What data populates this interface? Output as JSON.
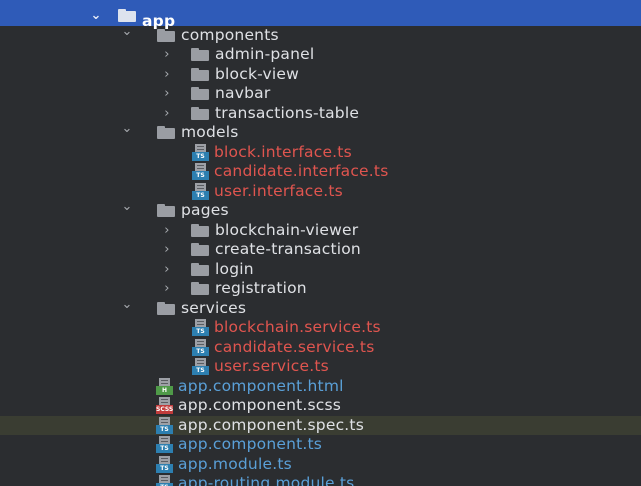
{
  "tree": {
    "colors": {
      "background": "#2b2d30",
      "selection": "#2f5bb8",
      "error_file": "#e0554f",
      "modified_file": "#5aa0d8",
      "normal_text": "#dfe1e5",
      "highlight_row": "#3a3d32"
    },
    "rows": [
      {
        "label": "app",
        "kind": "folder",
        "expanded": true,
        "state": "selected"
      },
      {
        "label": "components",
        "kind": "folder",
        "expanded": true
      },
      {
        "label": "admin-panel",
        "kind": "folder",
        "expanded": false
      },
      {
        "label": "block-view",
        "kind": "folder",
        "expanded": false
      },
      {
        "label": "navbar",
        "kind": "folder",
        "expanded": false
      },
      {
        "label": "transactions-table",
        "kind": "folder",
        "expanded": false
      },
      {
        "label": "models",
        "kind": "folder",
        "expanded": true
      },
      {
        "label": "block.interface.ts",
        "kind": "file",
        "icon": "TS",
        "status": "error"
      },
      {
        "label": "candidate.interface.ts",
        "kind": "file",
        "icon": "TS",
        "status": "error"
      },
      {
        "label": "user.interface.ts",
        "kind": "file",
        "icon": "TS",
        "status": "error"
      },
      {
        "label": "pages",
        "kind": "folder",
        "expanded": true
      },
      {
        "label": "blockchain-viewer",
        "kind": "folder",
        "expanded": false
      },
      {
        "label": "create-transaction",
        "kind": "folder",
        "expanded": false
      },
      {
        "label": "login",
        "kind": "folder",
        "expanded": false
      },
      {
        "label": "registration",
        "kind": "folder",
        "expanded": false
      },
      {
        "label": "services",
        "kind": "folder",
        "expanded": true
      },
      {
        "label": "blockchain.service.ts",
        "kind": "file",
        "icon": "TS",
        "status": "error"
      },
      {
        "label": "candidate.service.ts",
        "kind": "file",
        "icon": "TS",
        "status": "error"
      },
      {
        "label": "user.service.ts",
        "kind": "file",
        "icon": "TS",
        "status": "error"
      },
      {
        "label": "app.component.html",
        "kind": "file",
        "icon": "H",
        "status": "modified"
      },
      {
        "label": "app.component.scss",
        "kind": "file",
        "icon": "SCSS",
        "status": "normal"
      },
      {
        "label": "app.component.spec.ts",
        "kind": "file",
        "icon": "TS",
        "status": "normal",
        "state": "highlight"
      },
      {
        "label": "app.component.ts",
        "kind": "file",
        "icon": "TS",
        "status": "modified"
      },
      {
        "label": "app.module.ts",
        "kind": "file",
        "icon": "TS",
        "status": "modified"
      },
      {
        "label": "app-routing.module.ts",
        "kind": "file",
        "icon": "TS",
        "status": "modified"
      }
    ]
  }
}
